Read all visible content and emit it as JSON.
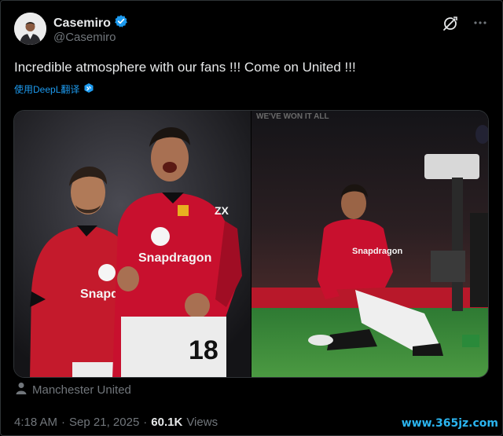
{
  "author": {
    "display_name": "Casemiro",
    "handle": "@Casemiro"
  },
  "tweet": {
    "text": "Incredible atmosphere with our fans !!! Come on United !!!",
    "translate_label": "使用DeepL翻译",
    "location": "Manchester United",
    "time": "4:18 AM",
    "date": "Sep 21, 2025",
    "views_count": "60.1K",
    "views_label": "Views"
  },
  "photos": {
    "photo1": {
      "sponsor_left": "Snapdr",
      "sponsor_right": "Snapdragon",
      "number": "18",
      "brand_mark": "ZX"
    },
    "photo2": {
      "sponsor": "Snapdragon",
      "banner": "WE'VE WON IT ALL"
    }
  },
  "watermark": "www.365jz.com",
  "colors": {
    "background": "#000000",
    "primary_text": "#e7e9ea",
    "secondary_text": "#71767b",
    "link": "#1d9bf0",
    "verified": "#1d9bf0",
    "kit_red": "#c8102e"
  },
  "icons": {
    "verified": "verified-badge-icon",
    "grok": "grok-icon",
    "more": "more-dots-icon",
    "translate": "translate-icon",
    "location": "location-icon"
  }
}
